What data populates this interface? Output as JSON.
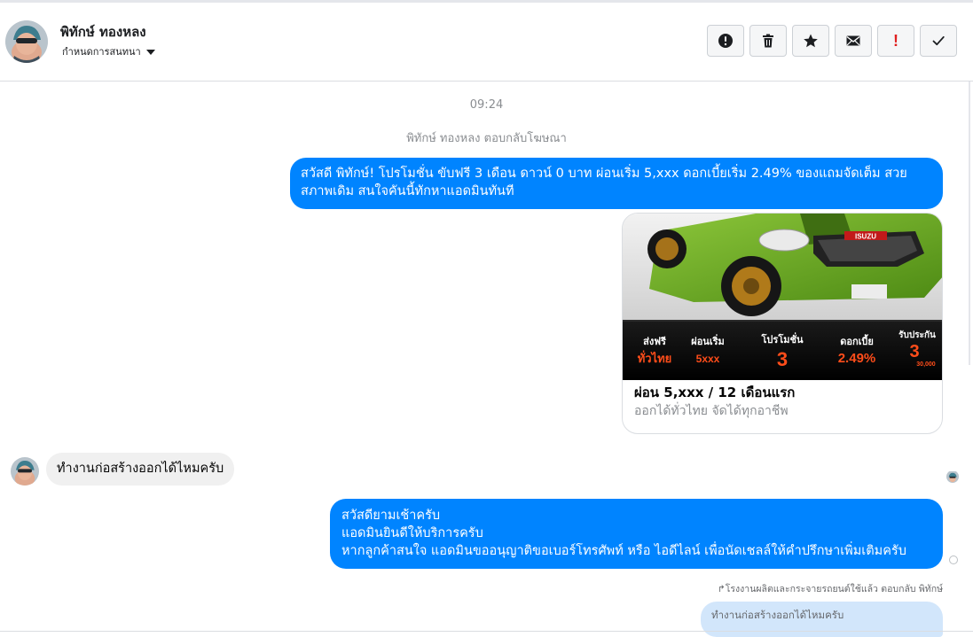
{
  "header": {
    "name": "พิทักษ์ ทองหลง",
    "subtitle": "กำหนดการสนทนา",
    "actions": [
      {
        "icon": "alert-circle-icon"
      },
      {
        "icon": "trash-icon"
      },
      {
        "icon": "star-icon"
      },
      {
        "icon": "envelope-icon"
      },
      {
        "icon": "exclamation-icon",
        "label": "!"
      },
      {
        "icon": "checkmark-icon"
      }
    ]
  },
  "conversation": {
    "timestamp": "09:24",
    "event": "พิทักษ์ ทองหลง ตอบกลับโฆษณา",
    "message1": "สวัสดี พิทักษ์! โปรโมชั่น ขับฟรี 3 เดือน ดาวน์ 0 บาท ผ่อนเริ่ม 5,xxx  ดอกเบี้ยเริ่ม 2.49% ของแถมจัดเต็ม สวยสภาพเดิม สนใจคันนี้ทักหาแอดมินทันที",
    "card": {
      "title": "ผ่อน 5,xxx / 12 เดือนแรก",
      "subtitle": "ออกได้ทั่วไทย จัดได้ทุกอาชีพ",
      "image": {
        "logo": "ISUZU",
        "promos": [
          {
            "top": "ส่งฟรี",
            "bottom": "ทั่วไทย"
          },
          {
            "top": "ผ่อนเริ่ม",
            "bottom": "5xxx"
          },
          {
            "top": "โปรโมชั่น",
            "bottom": "3"
          },
          {
            "top": "ดอกเบี้ย",
            "bottom": "2.49%"
          },
          {
            "top": "รับประกัน",
            "bottom": "3",
            "extra": "30,000"
          }
        ]
      }
    },
    "incoming": "ทำงานก่อสร้างออกได้ไหมครับ",
    "message2": [
      "สวัสดียามเช้าครับ",
      "แอดมินยินดีให้บริการครับ",
      "หากลูกค้าสนใจ แอดมินขออนุญาติขอเบอร์โทรศัพท์ หรือ ไอดีไลน์ เพื่อนัดเชลล์ให้คำปรึกษาเพิ่มเติมครับ"
    ],
    "reply_note": "↱โรงงานผลิตและกระจายรถยนต์ใช้แล้ว ตอบกลับ พิทักษ์",
    "quoted": "ทำงานก่อสร้างออกได้ไหมครับ"
  },
  "colors": {
    "outgoing": "#0084ff",
    "incoming": "#f0f0f0",
    "quoted": "#d2e6fb",
    "promo_orange": "#ff4d1a",
    "car_green": "#6aa51e"
  }
}
